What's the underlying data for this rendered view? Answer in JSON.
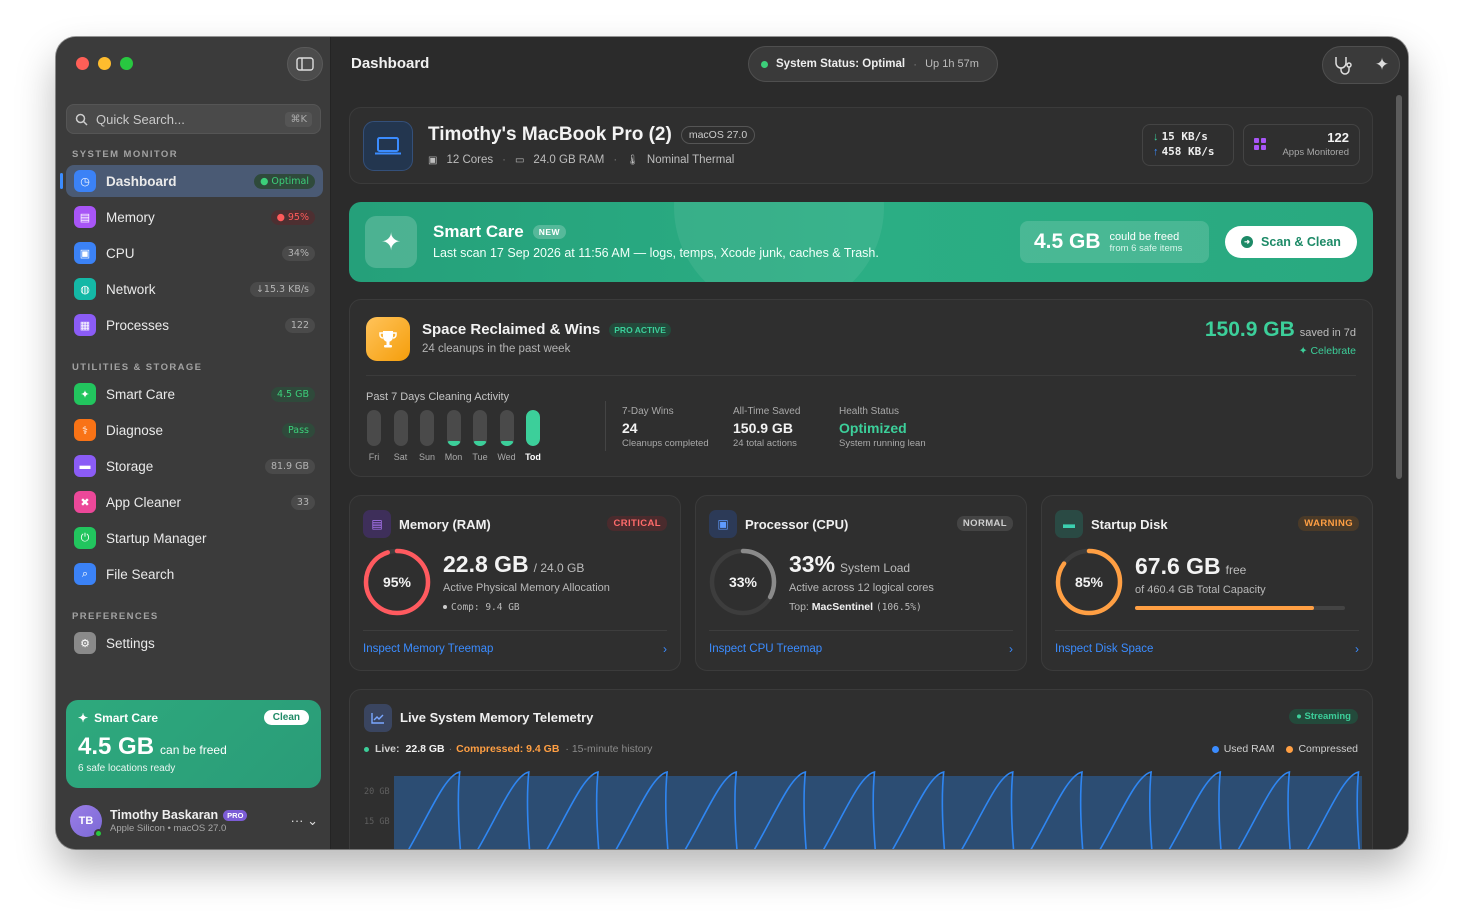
{
  "window": {
    "title": "Dashboard"
  },
  "sidebar": {
    "search_placeholder": "Quick Search...",
    "search_shortcut": "⌘K",
    "sections": {
      "monitor": "SYSTEM MONITOR",
      "utilities": "UTILITIES & STORAGE",
      "preferences": "PREFERENCES"
    },
    "items": [
      {
        "label": "Dashboard",
        "badge": "● Optimal",
        "badge_color": "#3ccf7a",
        "icon_color": "#3b82f6"
      },
      {
        "label": "Memory",
        "badge": "● 95%",
        "badge_color": "#ff5a5a",
        "icon_color": "#a855f7"
      },
      {
        "label": "CPU",
        "badge": "34%",
        "badge_color": "#b5b5b5",
        "icon_color": "#3b82f6"
      },
      {
        "label": "Network",
        "badge": "↓15.3 KB/s",
        "badge_color": "#b5b5b5",
        "icon_color": "#14b8a6"
      },
      {
        "label": "Processes",
        "badge": "122",
        "badge_color": "#b5b5b5",
        "icon_color": "#8b5cf6"
      },
      {
        "label": "Smart Care",
        "badge": "4.5 GB",
        "badge_color": "#3ccf7a",
        "icon_color": "#22c55e"
      },
      {
        "label": "Diagnose",
        "badge": "Pass",
        "badge_color": "#3ccf7a",
        "icon_color": "#f97316"
      },
      {
        "label": "Storage",
        "badge": "81.9 GB",
        "badge_color": "#b5b5b5",
        "icon_color": "#8b5cf6"
      },
      {
        "label": "App Cleaner",
        "badge": "33",
        "badge_color": "#b5b5b5",
        "icon_color": "#ec4899"
      },
      {
        "label": "Startup Manager",
        "badge": "",
        "badge_color": "#b5b5b5",
        "icon_color": "#22c55e"
      },
      {
        "label": "File Search",
        "badge": "",
        "badge_color": "#b5b5b5",
        "icon_color": "#3b82f6"
      },
      {
        "label": "Settings",
        "badge": "",
        "badge_color": "#b5b5b5",
        "icon_color": "#8a8a8a"
      }
    ],
    "smart_care_card": {
      "title": "Smart Care",
      "button": "Clean",
      "amount": "4.5 GB",
      "amount_suffix": "can be freed",
      "sub": "6 safe locations ready"
    },
    "user": {
      "initials": "TB",
      "name": "Timothy Baskaran",
      "badge": "PRO",
      "sub": "Apple Silicon • macOS 27.0"
    }
  },
  "topbar": {
    "title": "Dashboard",
    "status": "System Status: Optimal",
    "uptime": "Up 1h 57m"
  },
  "device": {
    "name": "Timothy's MacBook Pro (2)",
    "os": "macOS 27.0",
    "cores": "12 Cores",
    "ram": "24.0 GB RAM",
    "thermal": "Nominal Thermal",
    "down": "15  KB/s",
    "up": "458  KB/s",
    "apps_count": "122",
    "apps_label": "Apps Monitored"
  },
  "smart_care": {
    "title": "Smart Care",
    "badge": "NEW",
    "subtitle": "Last scan 17 Sep 2026 at 11:56 AM — logs, temps, Xcode junk, caches & Trash.",
    "amount": "4.5 GB",
    "amount_label": "could be freed",
    "amount_sub": "from 6 safe items",
    "button": "Scan & Clean"
  },
  "wins": {
    "title": "Space Reclaimed & Wins",
    "badge": "PRO ACTIVE",
    "subtitle": "24 cleanups in the past week",
    "saved": "150.9 GB",
    "saved_suffix": "saved in 7d",
    "celebrate": "Celebrate",
    "activity_label": "Past 7 Days Cleaning Activity",
    "days": [
      "Fri",
      "Sat",
      "Sun",
      "Mon",
      "Tue",
      "Wed",
      "Tod"
    ],
    "activity": [
      0,
      0,
      0,
      0.12,
      0.12,
      0.12,
      1.0
    ],
    "stats": [
      {
        "label": "7-Day Wins",
        "value": "24",
        "sub": "Cleanups completed"
      },
      {
        "label": "All-Time Saved",
        "value": "150.9 GB",
        "sub": "24 total actions"
      },
      {
        "label": "Health Status",
        "value": "Optimized",
        "sub": "System running lean"
      }
    ]
  },
  "memory": {
    "title": "Memory (RAM)",
    "status": "CRITICAL",
    "percent": "95%",
    "percent_value": 0.95,
    "value": "22.8 GB",
    "total": "/ 24.0 GB",
    "desc": "Active Physical Memory Allocation",
    "comp": "Comp: 9.4 GB",
    "link": "Inspect Memory Treemap",
    "color": "#ff5a5f"
  },
  "cpu": {
    "title": "Processor (CPU)",
    "status": "NORMAL",
    "percent": "33%",
    "percent_value": 0.33,
    "value": "33%",
    "value_suffix": "System Load",
    "desc": "Active across 12 logical cores",
    "top_label": "Top:",
    "top_proc": "MacSentinel",
    "top_val": "(106.5%)",
    "link": "Inspect CPU Treemap",
    "color": "#8a8a8a"
  },
  "disk": {
    "title": "Startup Disk",
    "status": "WARNING",
    "percent": "85%",
    "percent_value": 0.85,
    "value": "67.6 GB",
    "value_suffix": "free",
    "desc": "of 460.4 GB Total Capacity",
    "link": "Inspect Disk Space",
    "color": "#ff9f43"
  },
  "telemetry": {
    "title": "Live System Memory Telemetry",
    "badge": "● Streaming",
    "live_label": "Live:",
    "live_value": "22.8 GB",
    "compressed": "Compressed: 9.4 GB",
    "history": "· 15-minute history",
    "legend_used": "Used RAM",
    "legend_comp": "Compressed",
    "y_ticks": [
      "20 GB",
      "15 GB"
    ]
  },
  "colors": {
    "accent": "#3b82f6",
    "green": "#3ccf9a",
    "teal_banner": "#2aa57e"
  }
}
